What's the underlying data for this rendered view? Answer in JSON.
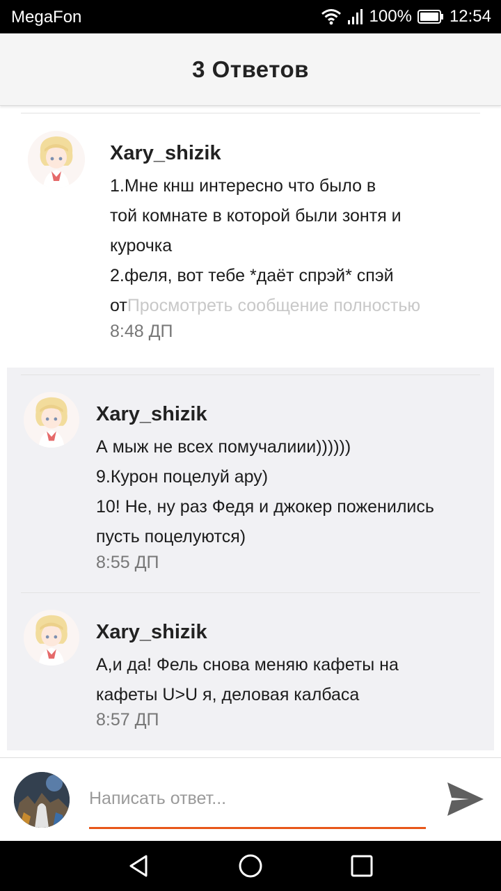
{
  "status_bar": {
    "carrier": "MegaFon",
    "battery": "100%",
    "time": "12:54"
  },
  "header": {
    "title": "3 Ответов"
  },
  "messages": [
    {
      "author": "Xary_shizik",
      "lines": [
        "1.Мне кнш интересно что было в",
        "той комнате в которой были зонтя и",
        "курочка",
        "2.феля, вот тебе *даёт спрэй* спэй"
      ],
      "last_line": "от",
      "more_link": "Просмотреть сообщение полностью",
      "time": "8:48 ДП"
    },
    {
      "author": "Xary_shizik",
      "lines": [
        "А мыж не всех помучалиии))))))",
        "9.Курон поцелуй ару)",
        "10! Не, ну раз Федя и джокер поженились",
        "пусть поцелуются)"
      ],
      "time": "8:55 ДП"
    },
    {
      "author": "Xary_shizik",
      "lines": [
        "А,и да! Фель снова меняю кафеты на",
        "кафеты U>U я, деловая калбаса"
      ],
      "time": "8:57 ДП"
    }
  ],
  "composer": {
    "placeholder": "Написать ответ..."
  },
  "icons": {
    "wifi": "wifi-icon",
    "signal": "signal-icon",
    "battery": "battery-icon",
    "send": "send-icon",
    "back": "back-icon",
    "home": "home-icon",
    "recents": "recents-icon"
  },
  "colors": {
    "accent": "#e8571a",
    "reply_background": "#f1f1f4",
    "header_background": "#f5f5f5",
    "send_icon": "#5f5f5f"
  }
}
